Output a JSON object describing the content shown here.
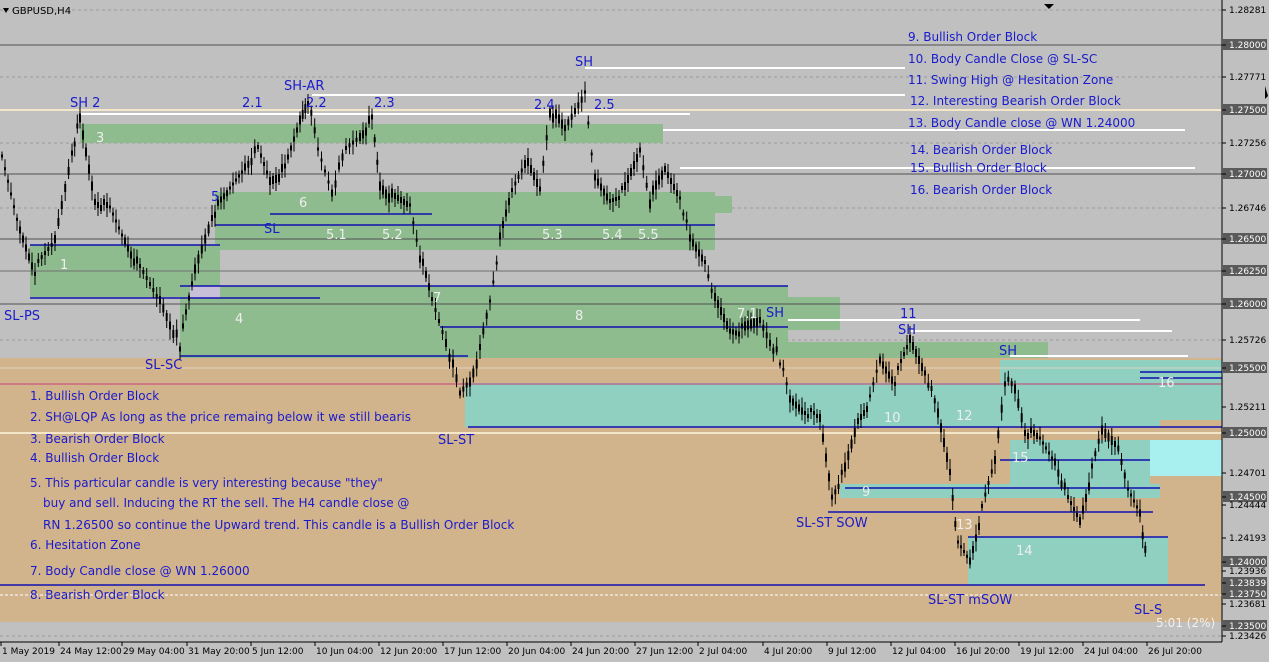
{
  "window_title": "GBPUSD,H4",
  "timer_text": "5:01 (2%)",
  "colors": {
    "background": "#c0c0c0",
    "support_zone": "#d2b48c",
    "order_block_green": "#8fbc8f",
    "teal_zone": "#8fd0c0",
    "cyan_box": "#a8f0f0",
    "annotation_text": "#1a1acd",
    "zone_label": "#eeeeee",
    "level_line": "#1010b0",
    "swing_line": "#ffffff",
    "candle": "#000000"
  },
  "price_axis": {
    "ticks": [
      "1.28281",
      "1.28000",
      "1.27771",
      "1.27500",
      "1.27256",
      "1.27000",
      "1.26746",
      "1.26500",
      "1.26250",
      "1.26000",
      "1.25726",
      "1.25500",
      "1.25211",
      "1.25000",
      "1.24701",
      "1.24500",
      "1.24444",
      "1.24193",
      "1.24000",
      "1.23936",
      "1.23839",
      "1.23750",
      "1.23681",
      "1.23500",
      "1.23426"
    ],
    "highlighted": [
      "1.28000",
      "1.27500",
      "1.27000",
      "1.26500",
      "1.26250",
      "1.26000",
      "1.25500",
      "1.25000",
      "1.24500",
      "1.24000",
      "1.23839",
      "1.23750",
      "1.23500"
    ]
  },
  "time_axis": [
    "1 May 2019",
    "24 May 12:00",
    "29 May 04:00",
    "31 May 20:00",
    "5 Jun 12:00",
    "10 Jun 04:00",
    "12 Jun 20:00",
    "17 Jun 12:00",
    "20 Jun 04:00",
    "24 Jun 20:00",
    "27 Jun 12:00",
    "2 Jul 04:00",
    "4 Jul 20:00",
    "9 Jul 12:00",
    "12 Jul 04:00",
    "16 Jul 20:00",
    "19 Jul 12:00",
    "24 Jul 04:00",
    "26 Jul 20:00"
  ],
  "legend_right": [
    "9. Bullish Order Block",
    "10. Body Candle Close @ SL-SC",
    "11. Swing High @ Hesitation Zone",
    "12. Interesting Bearish Order Block",
    "13. Body Candle close @ WN 1.24000",
    "14. Bearish Order Block",
    "15. Bullish Order Block",
    "16. Bearish Order Block"
  ],
  "legend_left": [
    "1. Bullish Order Block",
    "2. SH@LQP As long as the price remaing below it we still bearis",
    "3. Bearish Order Block",
    "4. Bullish Order Block",
    "5. This particular candle is very interesting because \"they\"",
    "buy and sell. Inducing  the RT the sell. The H4 candle close @",
    "RN 1.26500 so continue the Upward trend. This candle is a Bullish Order Block",
    "6. Hesitation Zone",
    "7. Body Candle close @ WN 1.26000",
    "8. Bearish Order Block"
  ],
  "chart_labels": [
    "SH 2",
    "3",
    "2.1",
    "SH-AR",
    "2.2",
    "2.3",
    "SH",
    "2.4",
    "2.5",
    "5",
    "6",
    "SL",
    "5.1",
    "5.2",
    "5.3",
    "5.4",
    "5.5",
    "1",
    "SL-PS",
    "4",
    "SL-SC",
    "7",
    "8",
    "7.1",
    "SH",
    "11",
    "SH",
    "SH",
    "SL-ST",
    "10",
    "12",
    "16",
    "15",
    "9",
    "SL-ST SOW",
    "13",
    "14",
    "SL-ST mSOW",
    "SL-S"
  ]
}
